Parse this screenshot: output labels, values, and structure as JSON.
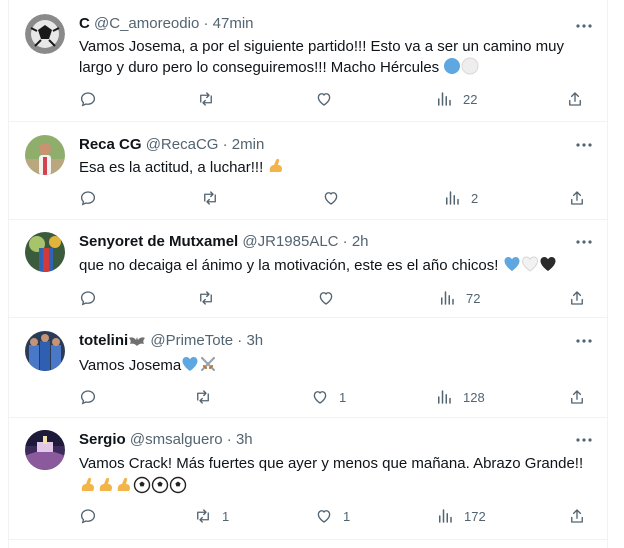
{
  "tweets": [
    {
      "name": "C",
      "handle": "@C_amoreodio",
      "dot": "·",
      "time": "47min",
      "text_line1": "Vamos Josema, a por el siguiente partido!!! Esto va a ser un camino muy",
      "text_line2": "largo y duro pero lo conseguiremos!!! Macho Hércules",
      "replies": "",
      "retweets": "",
      "likes": "",
      "views": "22"
    },
    {
      "name": "Reca CG",
      "handle": "@RecaCG",
      "dot": "·",
      "time": "2min",
      "text_line1": "Esa es la actitud, a luchar!!!",
      "replies": "",
      "retweets": "",
      "likes": "",
      "views": "2"
    },
    {
      "name": "Senyoret de Mutxamel",
      "handle": "@JR1985ALC",
      "dot": "·",
      "time": "2h",
      "text_line1": "que no decaiga el ánimo y la motivación, este es el año chicos!",
      "replies": "",
      "retweets": "",
      "likes": "",
      "views": "72"
    },
    {
      "name": "totelini",
      "handle": "@PrimeTote",
      "dot": "·",
      "time": "3h",
      "text_line1": "Vamos Josema",
      "replies": "",
      "retweets": "",
      "likes": "1",
      "views": "128"
    },
    {
      "name": "Sergio",
      "handle": "@smsalguero",
      "dot": "·",
      "time": "3h",
      "text_line1": "Vamos Crack! Más fuertes que ayer y menos que mañana. Abrazo Grande!!",
      "replies": "",
      "retweets": "1",
      "likes": "1",
      "views": "172"
    }
  ],
  "icons": {
    "reply": "reply-icon",
    "retweet": "retweet-icon",
    "like": "heart-icon",
    "views": "views-icon",
    "share": "share-icon",
    "more": "more-icon"
  },
  "colors": {
    "text": "#0f1419",
    "secondary": "#536471",
    "divider": "#eff3f4"
  }
}
